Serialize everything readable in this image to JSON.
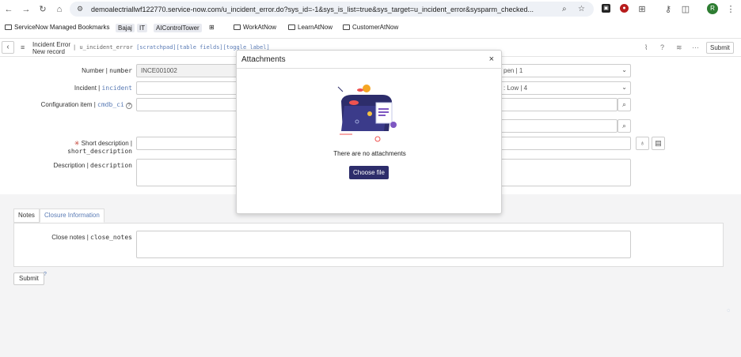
{
  "browser": {
    "url": "demoalectriallwf122770.service-now.com/u_incident_error.do?sys_id=-1&sys_is_list=true&sys_target=u_incident_error&sysparm_checked...",
    "profile_initial": "R"
  },
  "bookmarks": {
    "managed": "ServiceNow Managed Bookmarks",
    "items": [
      "Bajaj",
      "IT",
      "AIControlTower",
      "WorkAtNow",
      "LearnAtNow",
      "CustomerAtNow"
    ]
  },
  "header": {
    "title_line1": "Incident Error",
    "title_line2": "New record",
    "table_name": "| u_incident_error",
    "links": "[scratchpad][table fields][toggle label]",
    "submit_label": "Submit",
    "submit_q": "?"
  },
  "form": {
    "number_label": "Number | ",
    "number_field": "number",
    "number_value": "INCE001002",
    "incident_label": "Incident | ",
    "incident_field": "incident",
    "ci_label": "Configuration item | ",
    "ci_field": "cmdb_ci",
    "ci_help": "?",
    "short_desc_label": "Short description | ",
    "short_desc_field": "short_description",
    "req_mark": "✳",
    "desc_label": "Description | ",
    "desc_field": "description",
    "state_value": "pen | 1",
    "priority_value": ": Low | 4"
  },
  "tabs": [
    "Notes",
    "Closure Information"
  ],
  "closure": {
    "close_notes_label": "Close notes | ",
    "close_notes_field": "close_notes"
  },
  "bottom": {
    "submit_label": "Submit",
    "q": "?"
  },
  "modal": {
    "title": "Attachments",
    "close": "×",
    "empty_text": "There are no attachments",
    "choose_label": "Choose file"
  },
  "colors": {
    "accent": "#2d2d6b",
    "link": "#5a7bb5"
  }
}
